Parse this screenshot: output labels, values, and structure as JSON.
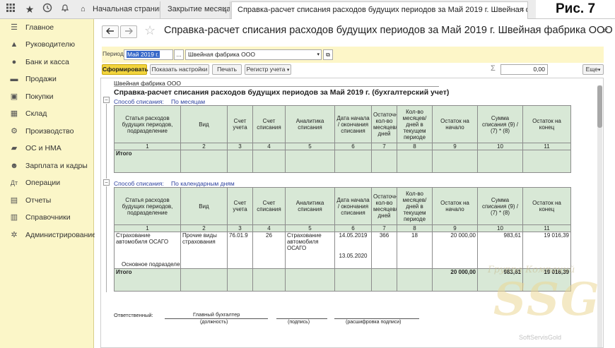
{
  "tabs": [
    {
      "label": "Начальная страница"
    },
    {
      "label": "Закрытие месяца",
      "close": "×"
    },
    {
      "label": "Справка-расчет списания расходов будущих периодов за Май 2019 г. Швейная фабрика ООО",
      "close": "×"
    }
  ],
  "corner_label": "Рис. 7",
  "sidebar": {
    "items": [
      {
        "label": "Главное",
        "icon": "menu-icon"
      },
      {
        "label": "Руководителю",
        "icon": "chart-icon"
      },
      {
        "label": "Банк и касса",
        "icon": "bank-icon"
      },
      {
        "label": "Продажи",
        "icon": "sales-icon"
      },
      {
        "label": "Покупки",
        "icon": "cart-icon"
      },
      {
        "label": "Склад",
        "icon": "warehouse-icon"
      },
      {
        "label": "Производство",
        "icon": "factory-icon"
      },
      {
        "label": "ОС и НМА",
        "icon": "assets-icon"
      },
      {
        "label": "Зарплата и кадры",
        "icon": "people-icon"
      },
      {
        "label": "Операции",
        "icon": "operations-icon"
      },
      {
        "label": "Отчеты",
        "icon": "reports-icon"
      },
      {
        "label": "Справочники",
        "icon": "book-icon"
      },
      {
        "label": "Администрирование",
        "icon": "gear-icon"
      }
    ]
  },
  "document": {
    "title": "Справка-расчет списания расходов будущих периодов за Май 2019 г. Швейная фабрика ООО",
    "period_label": "Период:",
    "period_value": "Май 2019 г.",
    "period_btn": "...",
    "org_value": "Швейная фабрика ООО"
  },
  "toolbar": {
    "generate": "Сформировать",
    "show_settings": "Показать настройки",
    "print": "Печать",
    "register": "Регистр учета",
    "sum_symbol": "Σ",
    "sum_value": "0,00",
    "more": "Еще"
  },
  "report": {
    "org": "Швейная фабрика ООО",
    "title": "Справка-расчет списания расходов будущих периодов  за Май 2019 г. (бухгалтерский учет)",
    "method1_label": "Способ списания:",
    "method1_value": "По месяцам",
    "method2_label": "Способ списания:",
    "method2_value": "По календарным дням",
    "headers": [
      "Статья расходов будущих периодов, подразделение",
      "Вид",
      "Счет учета",
      "Счет списания",
      "Аналитика списания",
      "Дата начала / окончания списания",
      "Остаточное кол-во месяцев/ дней",
      "Кол-во месяцев/ дней в текущем периоде",
      "Остаток на начало",
      "Сумма списания (9) / (7) * (8)",
      "Остаток на конец"
    ],
    "col_numbers": [
      "1",
      "2",
      "3",
      "4",
      "5",
      "6",
      "7",
      "8",
      "9",
      "10",
      "11"
    ],
    "total_label": "Итого",
    "row": {
      "article": "Страхование автомобиля ОСАГО",
      "kind": "Прочие виды страхования",
      "account": "76.01.9",
      "write_off_account": "26",
      "analytics": "Страхование автомобиля ОСАГО",
      "date_start": "14.05.2019",
      "date_end": "13.05.2020",
      "remaining": "366",
      "in_period": "18",
      "balance_start": "20 000,00",
      "write_off_sum": "983,61",
      "balance_end": "19 016,39",
      "department": "Основное подразделение"
    },
    "totals": {
      "balance_start": "20 000,00",
      "write_off_sum": "983,61",
      "balance_end": "19 016,39"
    },
    "signature": {
      "responsible": "Ответственный:",
      "position": "Главный бухгалтер",
      "position_caption": "(должность)",
      "sign_caption": "(подпись)",
      "decode_caption": "(расшифровка подписи)"
    }
  },
  "watermark": {
    "line1": "Группа Компаний",
    "logo": "SSG",
    "line2": "SoftServisGold"
  }
}
